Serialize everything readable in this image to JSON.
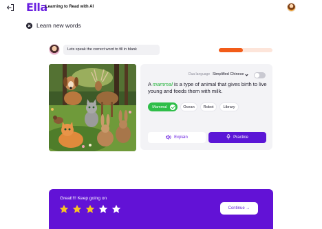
{
  "header": {
    "logo": "Ella",
    "tagline": "Learning to Read with AI"
  },
  "page": {
    "title": "Learn new words"
  },
  "assistant": {
    "prompt": "Lets speak the correct word to fill in blank"
  },
  "progress": {
    "fraction": 0.45,
    "fill_color": "#f25c19",
    "track_color": "#fde5da"
  },
  "card": {
    "dual_language_label": "Dua language",
    "dual_language_value": "Simplified Chinese",
    "dual_language_enabled": false,
    "sentence_before": "A ",
    "sentence_word": "mammal",
    "sentence_after": " is a type of animal that gives birth to live young and feeds them with milk.",
    "options": [
      {
        "label": "Mammal",
        "selected": true
      },
      {
        "label": "Ocean",
        "selected": false
      },
      {
        "label": "Robot",
        "selected": false
      },
      {
        "label": "Library",
        "selected": false
      }
    ],
    "explain_label": "Explain",
    "practice_label": "Practice"
  },
  "feedback": {
    "message": "Great!!!! Keep going on",
    "stars_filled": 3,
    "stars_total": 5,
    "continue_label": "Continue"
  },
  "colors": {
    "brand": "#6a1fe0",
    "primary_button": "#5b16d6",
    "banner": "#6212d6",
    "success": "#2fbe49",
    "star_filled": "#f7c325",
    "star_empty": "#ffffff"
  },
  "icons": {
    "back": "logout-arrow-icon",
    "close": "close-icon",
    "explain": "speaker-icon",
    "practice": "microphone-icon",
    "continue": "arrow-right-icon",
    "star": "star-icon",
    "check": "check-icon"
  }
}
